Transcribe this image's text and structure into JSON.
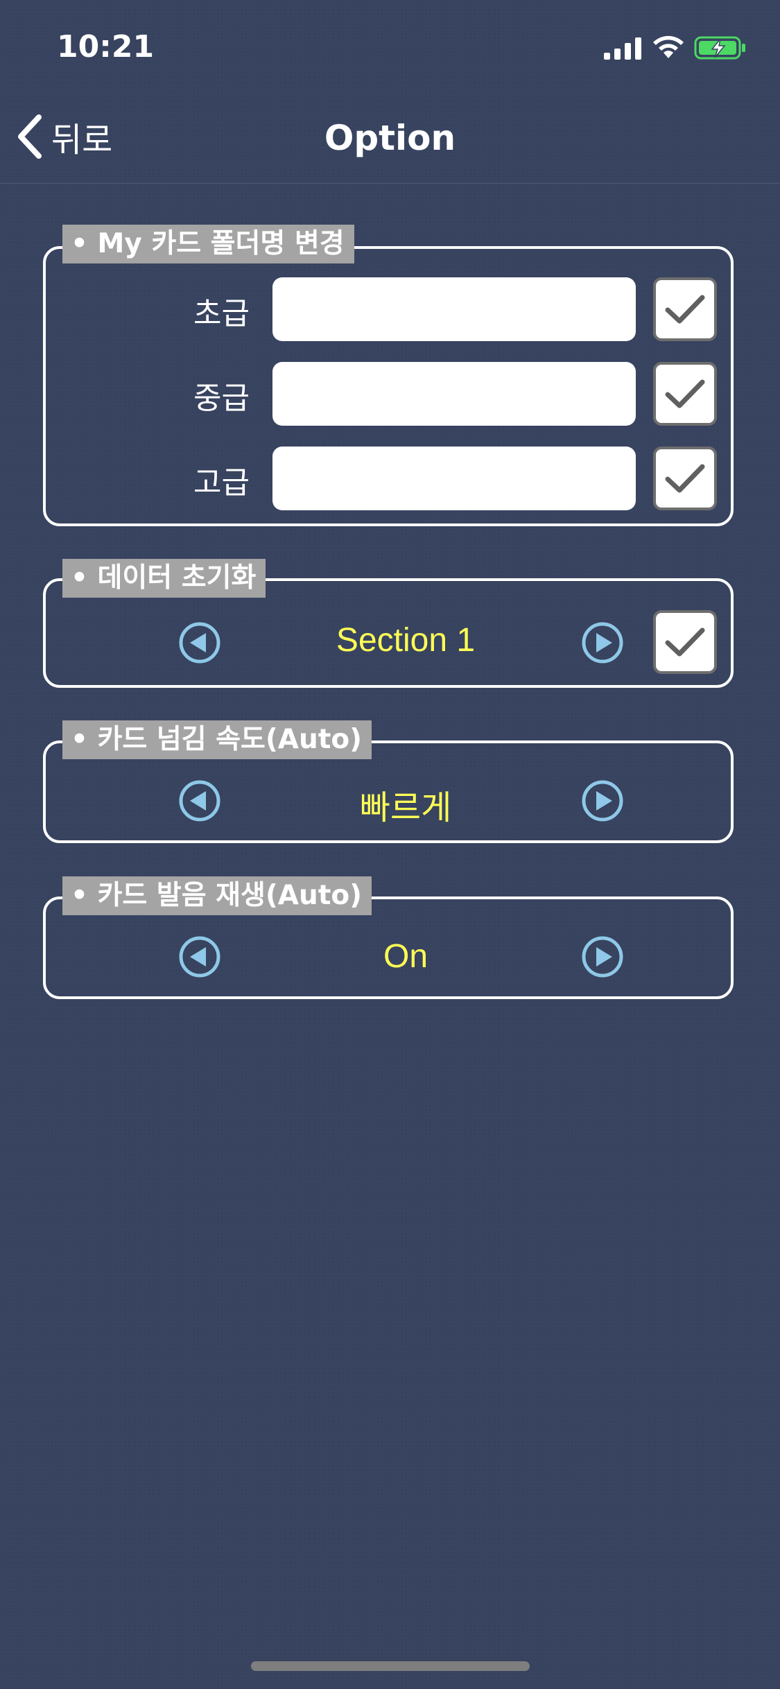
{
  "status_bar": {
    "time": "10:21",
    "icons": [
      "signal-icon",
      "wifi-icon",
      "battery-charging-icon"
    ]
  },
  "nav": {
    "back_label": "뒤로",
    "title": "Option"
  },
  "sections": {
    "folder_names": {
      "header": "• My 카드 폴더명 변경",
      "rows": [
        {
          "label": "초급",
          "value": "",
          "checked": true
        },
        {
          "label": "중급",
          "value": "",
          "checked": true
        },
        {
          "label": "고급",
          "value": "",
          "checked": true
        }
      ]
    },
    "data_reset": {
      "header": "• 데이터 초기화",
      "value": "Section 1",
      "checked": true
    },
    "flip_speed": {
      "header": "• 카드 넘김 속도(Auto)",
      "value": "빠르게"
    },
    "pronunciation": {
      "header": "• 카드 발음 재생(Auto)",
      "value": "On"
    }
  },
  "colors": {
    "background": "#37435f",
    "header_bg": "#a4a4a4",
    "value_text": "#ffff55",
    "arrow": "#8fc8e8",
    "checkmark": "#606060",
    "battery": "#4cd964"
  }
}
